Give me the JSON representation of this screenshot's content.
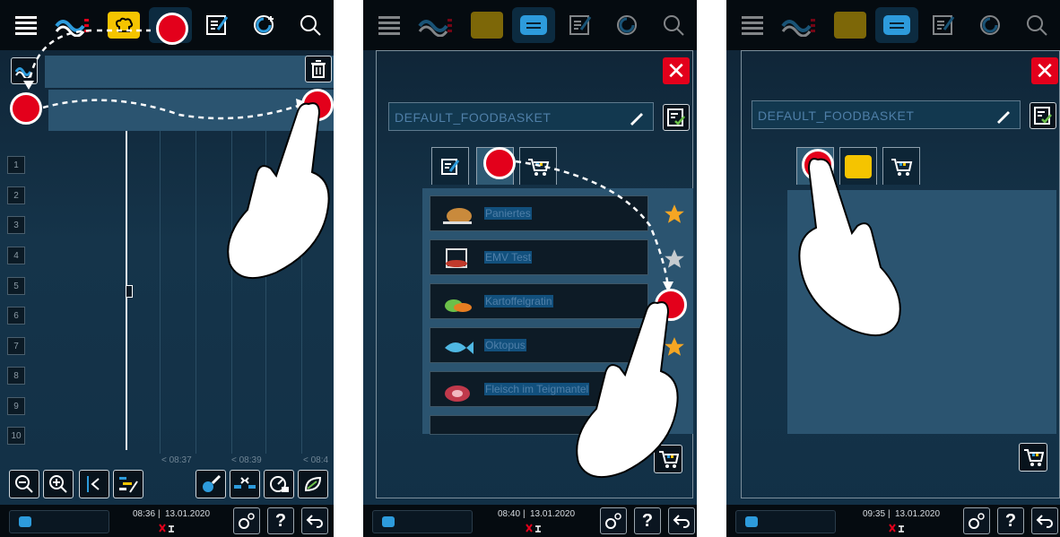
{
  "panel1": {
    "row_numbers": [
      "1",
      "2",
      "3",
      "4",
      "5",
      "6",
      "7",
      "8",
      "9",
      "10"
    ],
    "time_labels": [
      "< 08:37",
      "< 08:39",
      "< 08:4"
    ],
    "footer": {
      "time": "08:36",
      "date": "13.01.2020"
    }
  },
  "panel2": {
    "basket_name": "DEFAULT_FOODBASKET",
    "recipes": [
      "Paniertes",
      "EMV Test",
      "Kartoffelgratin",
      "Oktopus",
      "Fleisch im Teigmantel"
    ],
    "footer": {
      "time": "08:40",
      "date": "13.01.2020"
    }
  },
  "panel3": {
    "basket_name": "DEFAULT_FOODBASKET",
    "footer": {
      "time": "09:35",
      "date": "13.01.2020"
    }
  },
  "footer_help_label": "?",
  "colors": {
    "accent_red": "#e3001b",
    "tab_yellow": "#f5c400",
    "blue": "#2d9bdc"
  }
}
